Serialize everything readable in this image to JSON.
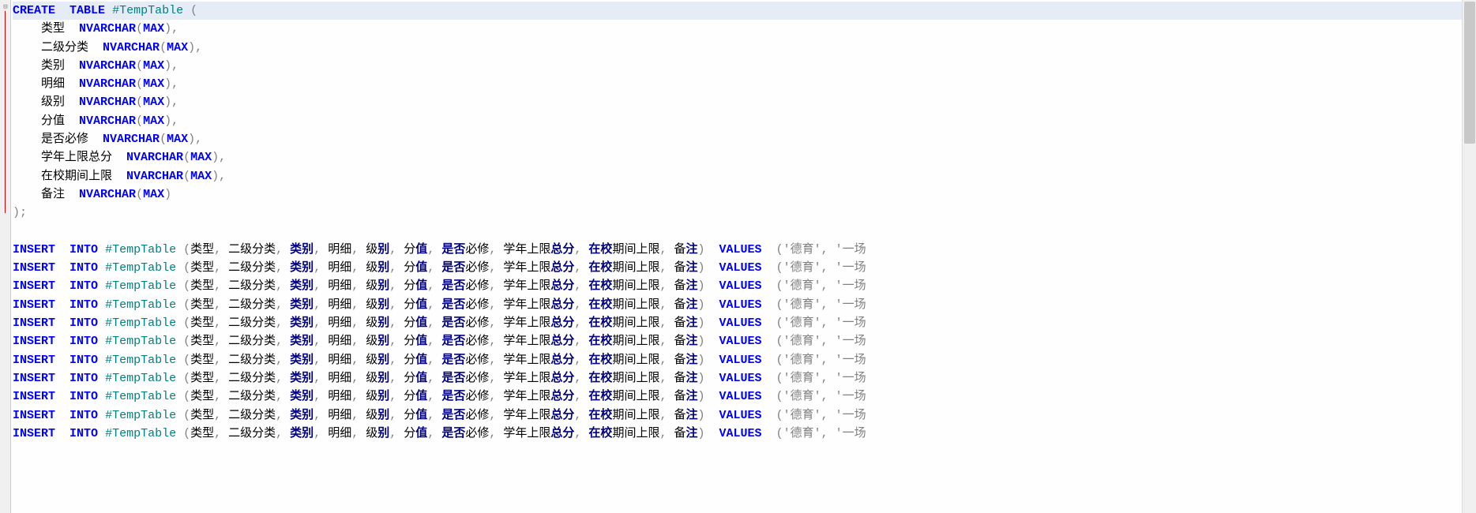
{
  "editor": {
    "highlightedLineIndex": 0,
    "foldMarker": "⊟",
    "createTable": {
      "keyword1": "CREATE",
      "keyword2": "TABLE",
      "tableName": "#TempTable",
      "openParen": "(",
      "columns": [
        {
          "name": "类型",
          "type": "NVARCHAR",
          "typeArg": "MAX",
          "trailingComma": true
        },
        {
          "name": "二级分类",
          "type": "NVARCHAR",
          "typeArg": "MAX",
          "trailingComma": true
        },
        {
          "name": "类别",
          "type": "NVARCHAR",
          "typeArg": "MAX",
          "trailingComma": true
        },
        {
          "name": "明细",
          "type": "NVARCHAR",
          "typeArg": "MAX",
          "trailingComma": true
        },
        {
          "name": "级别",
          "type": "NVARCHAR",
          "typeArg": "MAX",
          "trailingComma": true
        },
        {
          "name": "分值",
          "type": "NVARCHAR",
          "typeArg": "MAX",
          "trailingComma": true
        },
        {
          "name": "是否必修",
          "type": "NVARCHAR",
          "typeArg": "MAX",
          "trailingComma": true
        },
        {
          "name": "学年上限总分",
          "type": "NVARCHAR",
          "typeArg": "MAX",
          "trailingComma": true
        },
        {
          "name": "在校期间上限",
          "type": "NVARCHAR",
          "typeArg": "MAX",
          "trailingComma": true
        },
        {
          "name": "备注",
          "type": "NVARCHAR",
          "typeArg": "MAX",
          "trailingComma": false
        }
      ],
      "closeParen": ")",
      "terminator": ";"
    },
    "blankLine": "",
    "insertStatements": {
      "count": 11,
      "keyword1": "INSERT",
      "keyword2": "INTO",
      "tableName": "#TempTable",
      "openParen": "(",
      "columnList": [
        "类型",
        "二级分类",
        "类别",
        "明细",
        "级别",
        "分值",
        "是否必修",
        "学年上限总分",
        "在校期间上限",
        "备注"
      ],
      "closeParen": ")",
      "valuesKeyword": "VALUES",
      "valuesOpenParen": "(",
      "visibleValues": [
        "'德育'",
        "'一场"
      ],
      "colSep": ", "
    },
    "columnHighlightMap": {
      "类型": "类型",
      "二级分类": "二级分类",
      "类别": {
        "hl": "类别",
        "plain": ""
      },
      "明细": "明细",
      "级别": {
        "plain1": "级",
        "hl": "别",
        "plain2": ""
      },
      "分值": {
        "plain1": "分",
        "hl": "值",
        "plain2": ""
      },
      "是否必修": {
        "hl": "是否",
        "plain": "必修"
      },
      "学年上限总分": {
        "plain1": "学年上限",
        "hl": "总分",
        "plain2": ""
      },
      "在校期间上限": {
        "hl": "在校",
        "plain": "期间上限"
      },
      "备注": {
        "plain1": "备",
        "hl": "注",
        "plain2": ""
      }
    }
  }
}
